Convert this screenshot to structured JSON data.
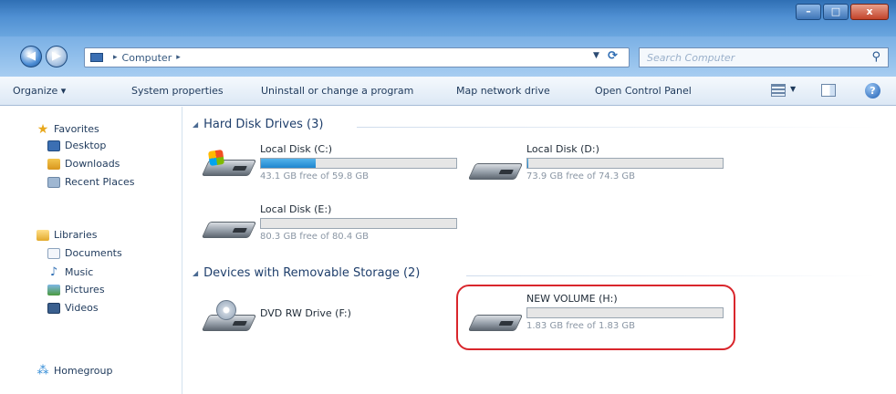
{
  "window": {
    "minimize": "–",
    "maximize": "□",
    "close": "x"
  },
  "address": {
    "root_label": "Computer",
    "chevron": "▸",
    "search_placeholder": "Search Computer"
  },
  "command_bar": {
    "organize": "Organize ▾",
    "system_properties": "System properties",
    "uninstall": "Uninstall or change a program",
    "map_drive": "Map network drive",
    "control_panel": "Open Control Panel"
  },
  "nav": {
    "favorites": "Favorites",
    "desktop": "Desktop",
    "downloads": "Downloads",
    "recent": "Recent Places",
    "libraries": "Libraries",
    "documents": "Documents",
    "music": "Music",
    "pictures": "Pictures",
    "videos": "Videos",
    "homegroup": "Homegroup"
  },
  "groups": {
    "hard_disks": "Hard Disk Drives (3)",
    "removable": "Devices with Removable Storage (2)"
  },
  "drives": [
    {
      "name": "Local Disk (C:)",
      "free": "43.1 GB free of 59.8 GB",
      "used_fraction": 0.28
    },
    {
      "name": "Local Disk (D:)",
      "free": "73.9 GB free of 74.3 GB",
      "used_fraction": 0.005
    },
    {
      "name": "Local Disk (E:)",
      "free": "80.3 GB free of 80.4 GB",
      "used_fraction": 0.002
    },
    {
      "name": "DVD RW Drive (F:)"
    },
    {
      "name": "NEW VOLUME (H:)",
      "free": "1.83 GB free of 1.83 GB",
      "used_fraction": 0.0
    }
  ],
  "colors": {
    "highlight": "#d9262c",
    "bar_fill": "#1f86cf"
  }
}
